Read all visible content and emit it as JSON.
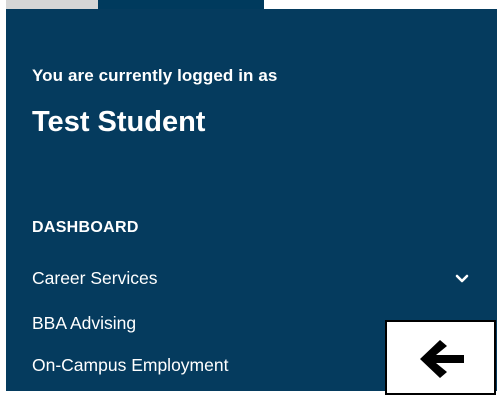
{
  "sidebar": {
    "logged_in_label": "You are currently logged in as",
    "user_name": "Test Student",
    "section_heading": "DASHBOARD",
    "items": [
      {
        "label": "Career Services",
        "icon": "chevron-down-icon"
      },
      {
        "label": "BBA Advising"
      },
      {
        "label": "On-Campus Employment"
      }
    ]
  },
  "back_button": {
    "icon": "arrow-left-icon"
  },
  "colors": {
    "panel_background": "#053b5e",
    "active_tab": "#003a5d",
    "inactive_tab": "#d6d6d6",
    "text": "#ffffff"
  }
}
